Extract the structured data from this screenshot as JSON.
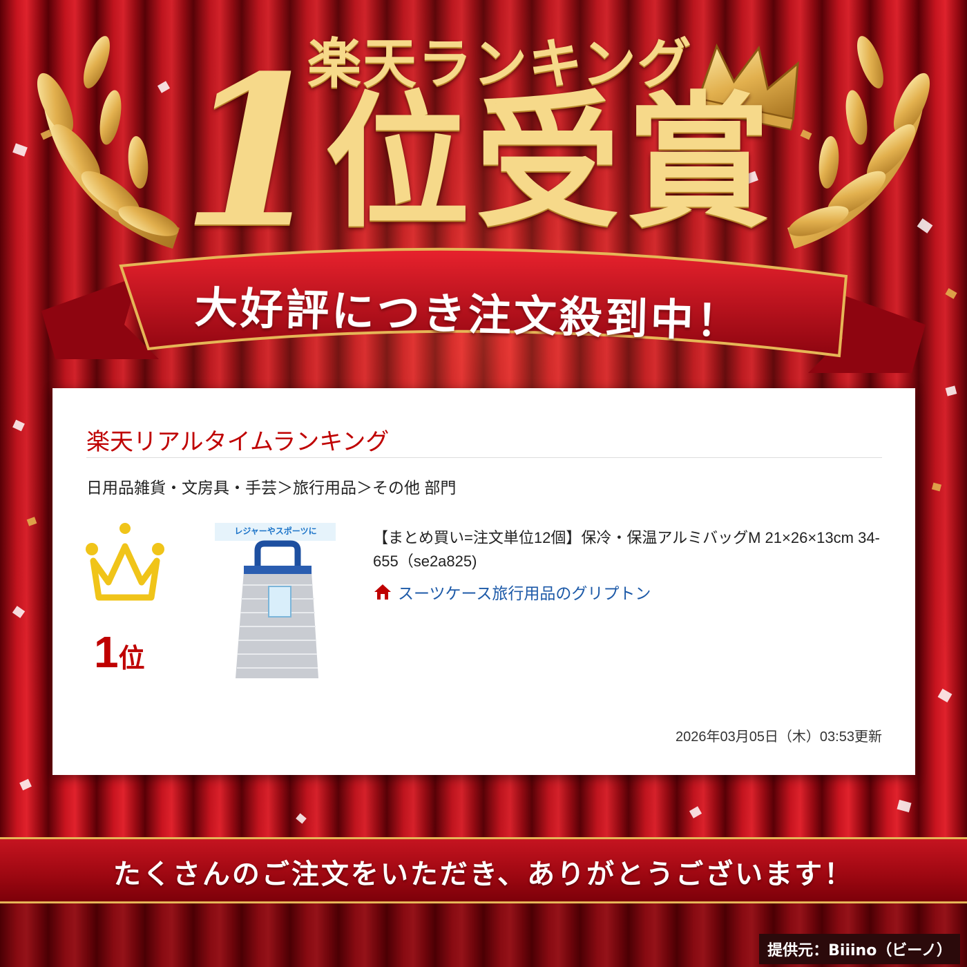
{
  "headline": {
    "top": "楽天ランキング",
    "number": "1",
    "award": "位受賞"
  },
  "ribbon": {
    "text": "大好評につき注文殺到中！"
  },
  "card": {
    "title": "楽天リアルタイムランキング",
    "category": "日用品雑貨・文房具・手芸＞旅行用品＞その他 部門",
    "rank": {
      "number": "1",
      "suffix": "位"
    },
    "product": {
      "banner_text": "レジャーやスポーツに",
      "title": "【まとめ買い=注文単位12個】保冷・保温アルミバッグM 21×26×13cm 34-655（se2a825)"
    },
    "shop": {
      "name": "スーツケース旅行用品のグリプトン",
      "icon": "home-icon"
    },
    "updated": "2026年03月05日（木）03:53更新"
  },
  "thanks": {
    "text": "たくさんのご注文をいただき、ありがとうございます！"
  },
  "provider": {
    "text": "提供元：Biiino（ビーノ）"
  },
  "colors": {
    "curtain_red": "#b0101a",
    "gold": "#f6d98a",
    "rakuten_red": "#bf0000",
    "link_blue": "#1d5aa8"
  }
}
